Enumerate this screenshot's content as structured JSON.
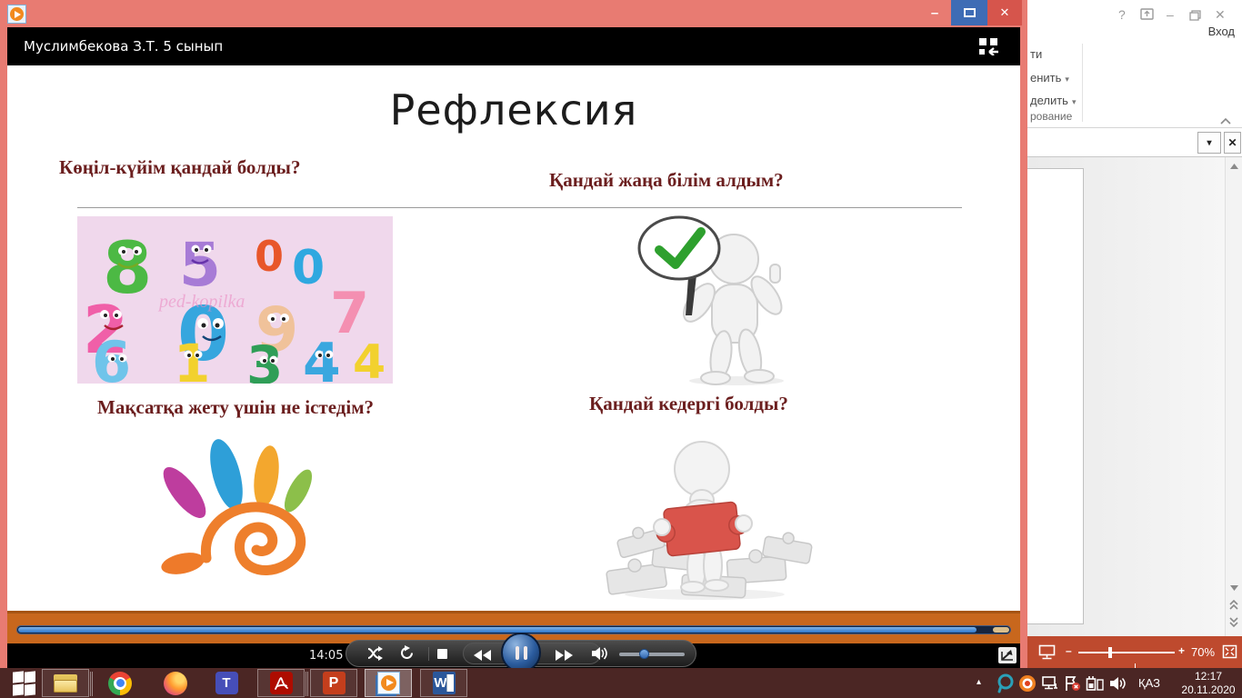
{
  "player": {
    "info_title": "Муслимбекова З.Т. 5 сынып",
    "time_label": "14:05",
    "progress_percent": 97,
    "titlebar_icons": {
      "minimize_glyph": "–",
      "close_glyph": "✕"
    }
  },
  "slide": {
    "title": "Рефлексия",
    "quadrants": [
      {
        "heading": "Көңіл-күйім қандай болды?",
        "image": "smiling-numbers"
      },
      {
        "heading": "Қандай жаңа білім алдым?",
        "image": "figure-with-check-sign"
      },
      {
        "heading": "Мақсатқа жету үшін не істедім?",
        "image": "colorful-hand-spiral"
      },
      {
        "heading": "Қандай кедергі болды?",
        "image": "figure-with-puzzle"
      }
    ],
    "watermark": "ped-kopilka"
  },
  "powerpoint": {
    "titlebar": {
      "help_glyph": "?",
      "minimize_glyph": "–",
      "close_glyph": "✕"
    },
    "sign_in": "Вход",
    "ribbon": {
      "find_fragment": "ти",
      "replace_fragment": "енить",
      "select_fragment": "делить",
      "group_fragment": "рование",
      "dropdown_glyph": "▾"
    },
    "findbar": {
      "dropdown_glyph": "▾",
      "close_glyph": "✕"
    },
    "status": {
      "zoom_out_glyph": "–",
      "zoom_in_glyph": "+",
      "zoom_level": "70%"
    }
  },
  "taskbar": {
    "apps": [
      {
        "name": "file-explorer",
        "open": true,
        "stacked": true
      },
      {
        "name": "chrome",
        "open": false
      },
      {
        "name": "firefox",
        "open": false
      },
      {
        "name": "teams",
        "open": false
      },
      {
        "name": "acrobat-reader",
        "open": true,
        "stacked": true
      },
      {
        "name": "powerpoint",
        "open": true
      },
      {
        "name": "media-player",
        "open": true,
        "active": true
      },
      {
        "name": "word",
        "open": true
      }
    ],
    "teams_letter": "T",
    "powerpoint_letter": "P",
    "word_letter": "W",
    "tray": {
      "hidden_icons_glyph": "▴",
      "language": "ҚАЗ",
      "time": "12:17",
      "date": "20.11.2020"
    }
  },
  "colors": {
    "player_frame": "#E87B72",
    "close_button": "#D6554C",
    "maximize_button": "#3E6CB5",
    "seek_band": "#C8671D",
    "seek_fill": "#3E8EE0",
    "heading_maroon": "#6B1E1E",
    "ppt_status_bar": "#BE4A2E",
    "taskbar": "#4B2624"
  }
}
